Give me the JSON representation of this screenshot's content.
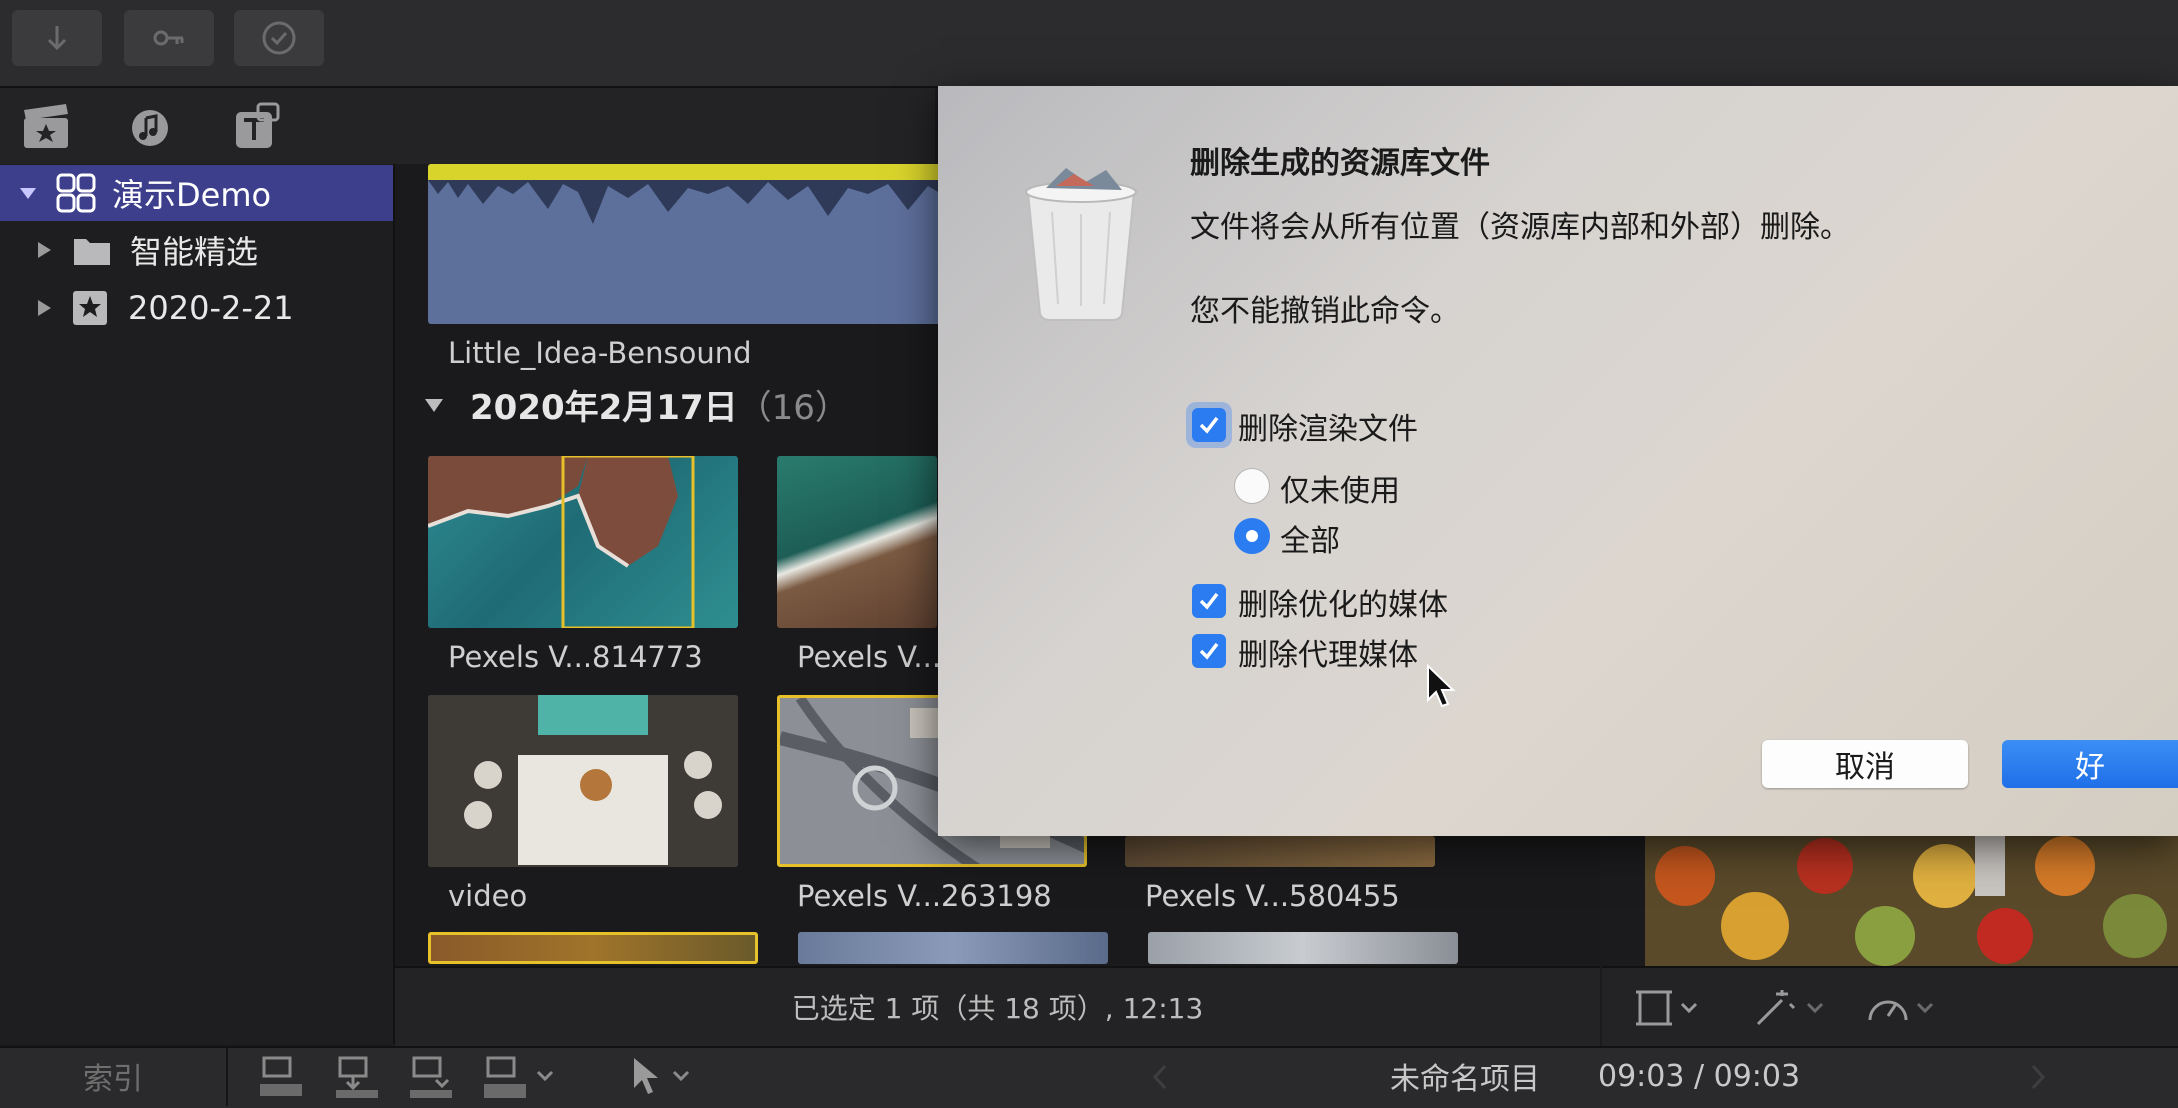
{
  "sidebar": {
    "items": [
      {
        "label": "演示Demo",
        "icon": "library-icon",
        "expanded": true,
        "selected": true
      },
      {
        "label": "智能精选",
        "icon": "folder-icon",
        "expanded": false
      },
      {
        "label": "2020-2-21",
        "icon": "star-event-icon",
        "expanded": false
      }
    ]
  },
  "browser": {
    "audio_clip_label": "Little_Idea-Bensound",
    "date_header": "2020年2月17日",
    "date_count": "（16）",
    "clips": [
      {
        "label": "Pexels V...814773"
      },
      {
        "label": "Pexels V..."
      },
      {
        "label": "video"
      },
      {
        "label": "Pexels V...263198"
      },
      {
        "label": "Pexels V...580455"
      }
    ]
  },
  "status_bar": {
    "text": "已选定 1 项（共 18 项）, 12:13"
  },
  "bottom_bar": {
    "index_label": "索引",
    "project_name": "未命名项目",
    "timecode": "09:03 / 09:03"
  },
  "dialog": {
    "title": "删除生成的资源库文件",
    "message": "文件将会从所有位置（资源库内部和外部）删除。",
    "warning": "您不能撤销此命令。",
    "delete_render": {
      "label": "删除渲染文件",
      "checked": true
    },
    "render_options": [
      {
        "label": "仅未使用",
        "selected": false
      },
      {
        "label": "全部",
        "selected": true
      }
    ],
    "delete_optimized": {
      "label": "删除优化的媒体",
      "checked": true
    },
    "delete_proxy": {
      "label": "删除代理媒体",
      "checked": true
    },
    "cancel_label": "取消",
    "ok_label": "好"
  },
  "colors": {
    "accent_blue": "#2b7cf0",
    "sidebar_selected": "#3d3f8c",
    "clip_selection": "#e6c12a"
  }
}
